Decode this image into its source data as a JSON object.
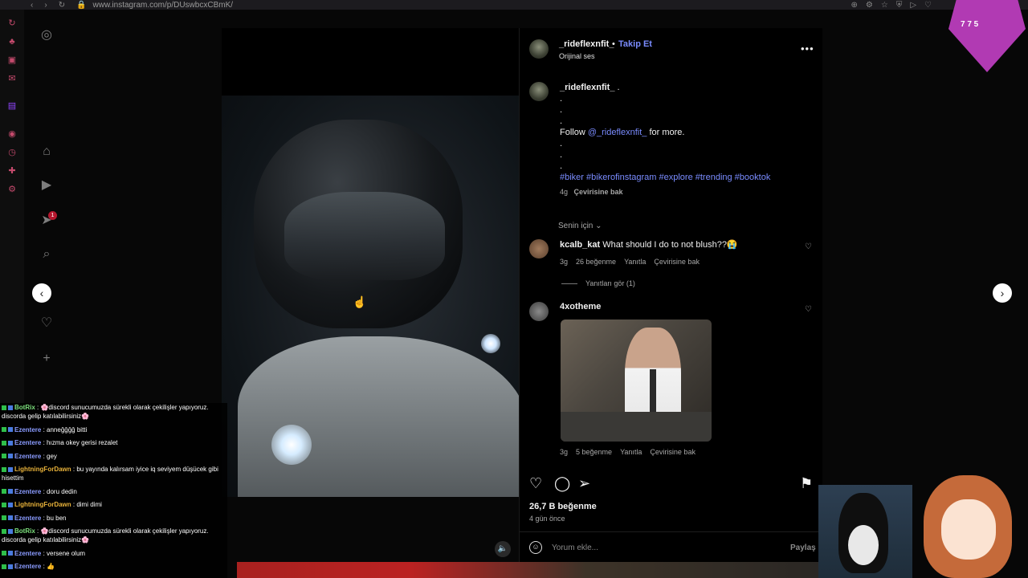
{
  "browser": {
    "url": "www.instagram.com/p/DUswbcxCBmK/"
  },
  "icons": {
    "back": "chevron-left-icon",
    "forward": "chevron-right-icon"
  },
  "post": {
    "author": "_rideflexnfit_",
    "dot": "•",
    "follow_label": "Takip Et",
    "audio": "Orijinal ses",
    "caption_author": "_rideflexnfit_",
    "caption_period": ".",
    "caption_dots": [
      ".",
      ".",
      "."
    ],
    "caption_follow": "Follow",
    "caption_mention": "@_rideflexnfit_",
    "caption_more": "for more.",
    "caption_dots2": [
      ".",
      ".",
      "."
    ],
    "hashtags": "#biker #bikerofinstagram #explore #trending #booktok",
    "caption_age": "4g",
    "caption_translate": "Çevirisine bak",
    "sort_label": "Senin için",
    "likes": "26,7 B beğenme",
    "posted": "4 gün önce",
    "comment_placeholder": "Yorum ekle...",
    "share_label": "Paylaş"
  },
  "comments": [
    {
      "user": "kcalb_kat",
      "text": "What should I do to not blush??😭",
      "age": "3g",
      "likes": "26 beğenme",
      "reply": "Yanıtla",
      "translate": "Çevirisine bak",
      "view_replies": "Yanıtları gör (1)"
    },
    {
      "user": "4xotheme",
      "text": "",
      "age": "3g",
      "likes": "5 beğenme",
      "reply": "Yanıtla",
      "translate": "Çevirisine bak"
    }
  ],
  "chat": [
    {
      "user": "BotRix",
      "cls": "n3",
      "text": " : 🌸discord sunucumuzda sürekli olarak çekilişler yapıyoruz. discorda gelip katılabilirsiniz🌸"
    },
    {
      "user": "Ezentere",
      "cls": "n1",
      "text": " : anneğğğğ bitti"
    },
    {
      "user": "Ezentere",
      "cls": "n1",
      "text": " : hızma okey gerisi rezalet"
    },
    {
      "user": "Ezentere",
      "cls": "n1",
      "text": " : gey"
    },
    {
      "user": "LightningForDawn",
      "cls": "n2",
      "text": " : bu yayında kalırsam iyice iq seviyem düşücek gibi hisettim"
    },
    {
      "user": "Ezentere",
      "cls": "n1",
      "text": " : doru dedin"
    },
    {
      "user": "LightningForDawn",
      "cls": "n2",
      "text": " : dimi dimi"
    },
    {
      "user": "Ezentere",
      "cls": "n1",
      "text": " : bu ben"
    },
    {
      "user": "BotRix",
      "cls": "n3",
      "text": " : 🌸discord sunucumuzda sürekli olarak çekilişler yapıyoruz. discorda gelip katılabilirsiniz🌸"
    },
    {
      "user": "Ezentere",
      "cls": "n1",
      "text": " : versene olum"
    },
    {
      "user": "Ezentere",
      "cls": "n1",
      "text": " : 👍"
    }
  ],
  "overlay": {
    "stats": "7  7  5"
  },
  "notifications_badge": "1"
}
